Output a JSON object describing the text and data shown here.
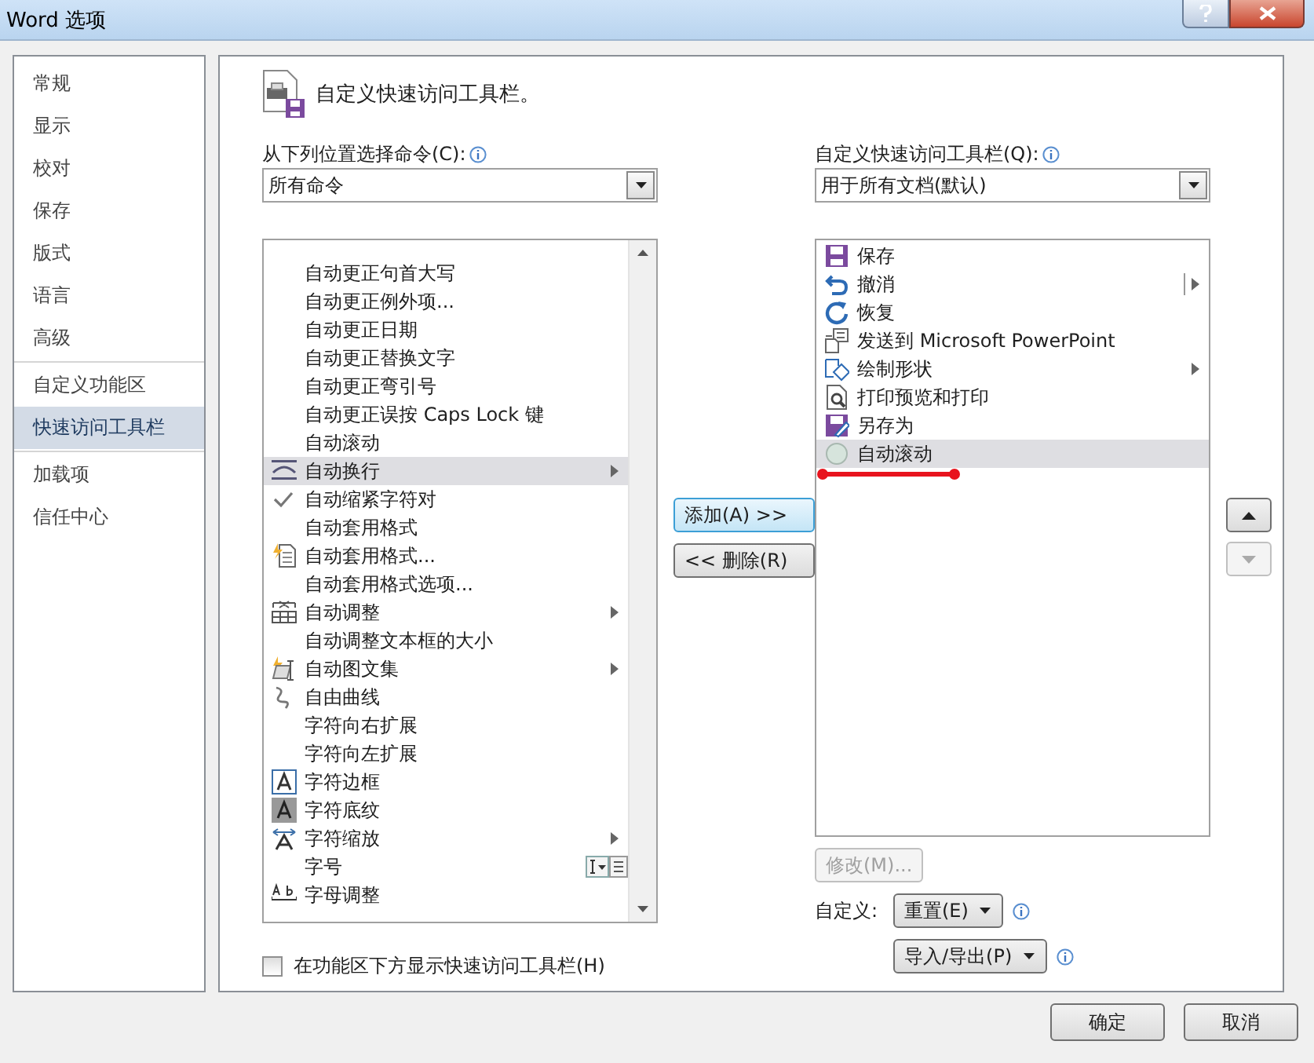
{
  "window": {
    "title": "Word 选项"
  },
  "sidebar": {
    "items": [
      {
        "label": "常规",
        "selected": false,
        "separator_before": false
      },
      {
        "label": "显示",
        "selected": false,
        "separator_before": false
      },
      {
        "label": "校对",
        "selected": false,
        "separator_before": false
      },
      {
        "label": "保存",
        "selected": false,
        "separator_before": false
      },
      {
        "label": "版式",
        "selected": false,
        "separator_before": false
      },
      {
        "label": "语言",
        "selected": false,
        "separator_before": false
      },
      {
        "label": "高级",
        "selected": false,
        "separator_before": false
      },
      {
        "label": "自定义功能区",
        "selected": false,
        "separator_before": true
      },
      {
        "label": "快速访问工具栏",
        "selected": true,
        "separator_before": false
      },
      {
        "label": "加载项",
        "selected": false,
        "separator_before": true
      },
      {
        "label": "信任中心",
        "selected": false,
        "separator_before": false
      }
    ]
  },
  "heading": "自定义快速访问工具栏。",
  "choose_from": {
    "label": "从下列位置选择命令(C):",
    "value": "所有命令"
  },
  "commands": [
    {
      "label": "自动更正句首大写",
      "kind": "plain",
      "submenu": false,
      "selected": false
    },
    {
      "label": "自动更正例外项...",
      "kind": "plain",
      "submenu": false,
      "selected": false
    },
    {
      "label": "自动更正日期",
      "kind": "plain",
      "submenu": false,
      "selected": false
    },
    {
      "label": "自动更正替换文字",
      "kind": "plain",
      "submenu": false,
      "selected": false
    },
    {
      "label": "自动更正弯引号",
      "kind": "plain",
      "submenu": false,
      "selected": false
    },
    {
      "label": "自动更正误按 Caps Lock 键",
      "kind": "plain",
      "submenu": false,
      "selected": false
    },
    {
      "label": "自动滚动",
      "kind": "plain",
      "submenu": false,
      "selected": false
    },
    {
      "label": "自动换行",
      "kind": "wrap",
      "submenu": true,
      "selected": true
    },
    {
      "label": "自动缩紧字符对",
      "kind": "check",
      "submenu": false,
      "selected": false
    },
    {
      "label": "自动套用格式",
      "kind": "plain",
      "submenu": false,
      "selected": false
    },
    {
      "label": "自动套用格式...",
      "kind": "autoformat",
      "submenu": false,
      "selected": false
    },
    {
      "label": "自动套用格式选项...",
      "kind": "plain",
      "submenu": false,
      "selected": false
    },
    {
      "label": "自动调整",
      "kind": "autofit",
      "submenu": true,
      "selected": false
    },
    {
      "label": "自动调整文本框的大小",
      "kind": "plain",
      "submenu": false,
      "selected": false
    },
    {
      "label": "自动图文集",
      "kind": "autotext",
      "submenu": true,
      "selected": false
    },
    {
      "label": "自由曲线",
      "kind": "freeform",
      "submenu": false,
      "selected": false
    },
    {
      "label": "字符向右扩展",
      "kind": "plain",
      "submenu": false,
      "selected": false
    },
    {
      "label": "字符向左扩展",
      "kind": "plain",
      "submenu": false,
      "selected": false
    },
    {
      "label": "字符边框",
      "kind": "border",
      "submenu": false,
      "selected": false
    },
    {
      "label": "字符底纹",
      "kind": "shading",
      "submenu": false,
      "selected": false
    },
    {
      "label": "字符缩放",
      "kind": "scale",
      "submenu": true,
      "selected": false
    },
    {
      "label": "字号",
      "kind": "fontsize",
      "submenu": false,
      "selected": false
    },
    {
      "label": "字母调整",
      "kind": "letter",
      "submenu": false,
      "selected": false
    }
  ],
  "customize_for": {
    "label": "自定义快速访问工具栏(Q):",
    "value": "用于所有文档(默认)"
  },
  "toolbar_items": [
    {
      "label": "保存",
      "kind": "save",
      "submenu": false,
      "selected": false
    },
    {
      "label": "撤消",
      "kind": "undo",
      "submenu": true,
      "selected": false
    },
    {
      "label": "恢复",
      "kind": "redo",
      "submenu": false,
      "selected": false
    },
    {
      "label": "发送到 Microsoft PowerPoint",
      "kind": "send",
      "submenu": false,
      "selected": false
    },
    {
      "label": "绘制形状",
      "kind": "shape",
      "submenu": true,
      "selected": false
    },
    {
      "label": "打印预览和打印",
      "kind": "preview",
      "submenu": false,
      "selected": false
    },
    {
      "label": "另存为",
      "kind": "saveas",
      "submenu": false,
      "selected": false
    },
    {
      "label": "自动滚动",
      "kind": "circle",
      "submenu": false,
      "selected": true
    }
  ],
  "add_button": "添加(A) >>",
  "remove_button": "<< 删除(R)",
  "move_up_disabled": false,
  "move_down_disabled": true,
  "modify_button": {
    "label": "修改(M)...",
    "disabled": true
  },
  "customizations_label": "自定义:",
  "reset_button": "重置(E)",
  "import_export_button": "导入/导出(P)",
  "show_below_ribbon": {
    "label": "在功能区下方显示快速访问工具栏(H)",
    "checked": false
  },
  "footer_buttons": [
    "确定",
    "取消"
  ]
}
